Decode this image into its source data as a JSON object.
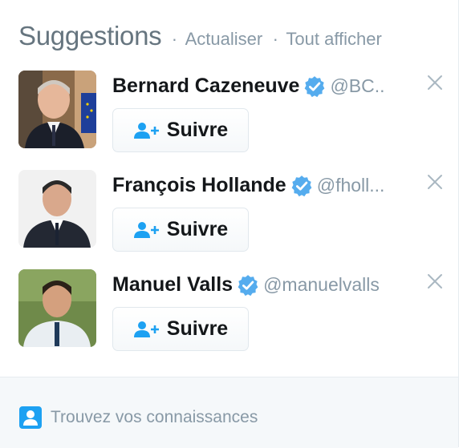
{
  "header": {
    "title": "Suggestions",
    "separator": "·",
    "refresh_label": "Actualiser",
    "view_all_label": "Tout afficher"
  },
  "suggestions": [
    {
      "name": "Bernard Cazeneuve",
      "handle": "@BC..",
      "verified": true,
      "follow_label": "Suivre",
      "dismiss_icon": "close-icon"
    },
    {
      "name": "François Hollande",
      "handle": "@fholl...",
      "verified": true,
      "follow_label": "Suivre",
      "dismiss_icon": "close-icon"
    },
    {
      "name": "Manuel Valls",
      "handle": "@manuelvalls",
      "verified": true,
      "follow_label": "Suivre",
      "dismiss_icon": "close-icon"
    }
  ],
  "footer": {
    "icon": "contacts-icon",
    "label": "Trouvez vos connaissances"
  },
  "colors": {
    "accent": "#1da1f2",
    "verified": "#55acee",
    "muted": "#8899a6",
    "footer_bg": "#f5f8fa"
  }
}
